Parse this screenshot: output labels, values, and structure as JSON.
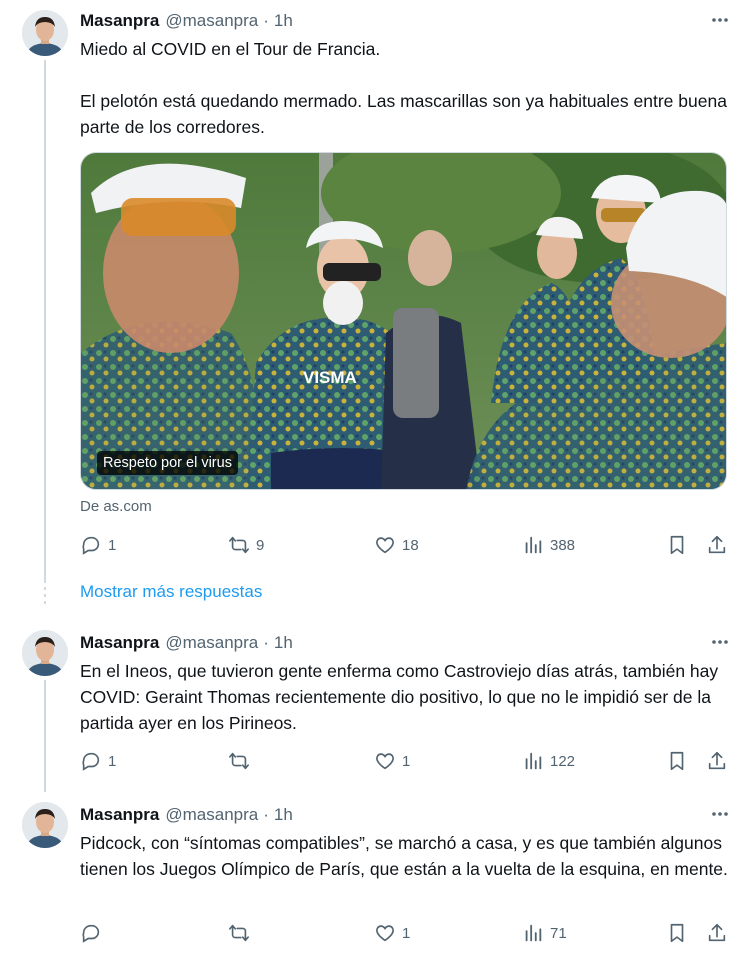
{
  "tweets": [
    {
      "author": "Masanpra",
      "handle": "@masanpra",
      "time": "1h",
      "text": "Miedo al COVID en el Tour de Francia.\n\nEl pelotón está quedando mermado.  Las mascarillas son ya habituales entre buena parte de los corredores.",
      "media_caption": "Respeto por el virus",
      "source": "De as.com",
      "replies": "1",
      "retweets": "9",
      "likes": "18",
      "views": "388"
    },
    {
      "author": "Masanpra",
      "handle": "@masanpra",
      "time": "1h",
      "text": "En el Ineos, que tuvieron gente enferma como Castroviejo días atrás, también hay COVID: Geraint Thomas recientemente dio positivo, lo que no le impidió ser de la partida ayer en los Pirineos.",
      "replies": "1",
      "retweets": "",
      "likes": "1",
      "views": "122"
    },
    {
      "author": "Masanpra",
      "handle": "@masanpra",
      "time": "1h",
      "text": "Pidcock, con “síntomas compatibles”, se marchó a casa, y es que también algunos tienen los Juegos Olímpico de París, que están a la vuelta de la esquina, en mente.",
      "replies": "",
      "retweets": "",
      "likes": "1",
      "views": "71"
    }
  ],
  "show_more_label": "Mostrar más respuestas",
  "colors": {
    "text": "#0f1419",
    "muted": "#536471",
    "link": "#1d9bf0",
    "line": "#cfd9de"
  },
  "icons": [
    "more-icon",
    "reply-icon",
    "retweet-icon",
    "like-icon",
    "views-icon",
    "bookmark-icon",
    "share-icon"
  ]
}
